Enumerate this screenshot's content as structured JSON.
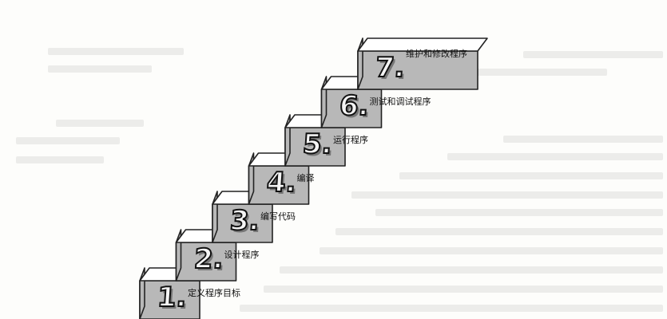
{
  "steps": [
    {
      "number": "1.",
      "label": "定义程序目标"
    },
    {
      "number": "2.",
      "label": "设计程序"
    },
    {
      "number": "3.",
      "label": "编写代码"
    },
    {
      "number": "4.",
      "label": "编译"
    },
    {
      "number": "5.",
      "label": "运行程序"
    },
    {
      "number": "6.",
      "label": "测试和调试程序"
    },
    {
      "number": "7.",
      "label": "维护和修改程序"
    }
  ],
  "colors": {
    "tread": "#ffffff",
    "riser": "#b8b8b8",
    "outline": "#222222"
  }
}
